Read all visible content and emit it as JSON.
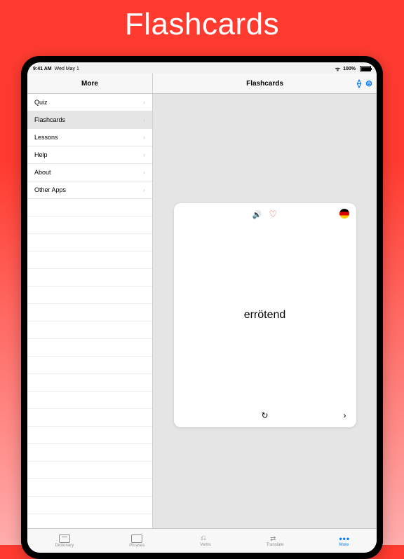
{
  "hero": {
    "title": "Flashcards"
  },
  "status": {
    "time": "9:41 AM",
    "date": "Wed May 1",
    "battery": "100%"
  },
  "leftNav": {
    "title": "More"
  },
  "menu": {
    "items": [
      {
        "label": "Quiz"
      },
      {
        "label": "Flashcards"
      },
      {
        "label": "Lessons"
      },
      {
        "label": "Help"
      },
      {
        "label": "About"
      },
      {
        "label": "Other Apps"
      }
    ],
    "selectedIndex": 1
  },
  "rightNav": {
    "title": "Flashcards"
  },
  "card": {
    "word": "errötend",
    "flag": "de"
  },
  "tabs": {
    "items": [
      {
        "label": "Dictionary"
      },
      {
        "label": "Phrases"
      },
      {
        "label": "Verbs"
      },
      {
        "label": "Translate"
      },
      {
        "label": "More"
      }
    ],
    "activeIndex": 4
  }
}
